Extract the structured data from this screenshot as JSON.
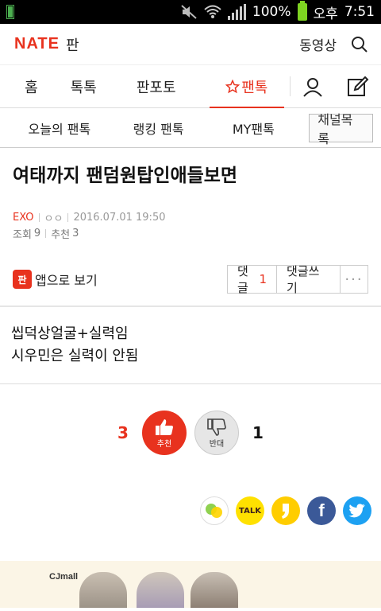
{
  "status_bar": {
    "battery_percent": "100%",
    "ampm": "오후",
    "time": "7:51"
  },
  "header": {
    "logo": "NATE",
    "section": "판",
    "video_link": "동영상"
  },
  "main_nav": {
    "tabs": [
      {
        "label": "홈"
      },
      {
        "label": "톡톡"
      },
      {
        "label": "판포토"
      },
      {
        "label": "팬톡",
        "active": true
      }
    ]
  },
  "sub_nav": {
    "tabs": [
      {
        "label": "오늘의 팬톡"
      },
      {
        "label": "랭킹 팬톡"
      },
      {
        "label": "MY팬톡"
      }
    ],
    "channel_button": "채널목록"
  },
  "article": {
    "title": "여태까지 팬덤원탑인애들보면",
    "channel": "EXO",
    "author": "ㅇㅇ",
    "datetime": "2016.07.01 19:50",
    "views_label": "조회",
    "views": "9",
    "recommend_label": "추천",
    "recommend": "3",
    "body_lines": [
      "씹덕상얼굴+실력임",
      "시우민은 실력이 안됨"
    ]
  },
  "actions": {
    "app_badge": "판",
    "app_view": "앱으로 보기",
    "comments_label": "댓글",
    "comments_count": "1",
    "write_comment": "댓글쓰기",
    "more": "···"
  },
  "votes": {
    "up_count": "3",
    "up_label": "추천",
    "down_label": "반대",
    "down_count": "1"
  },
  "share": {
    "talk_label": "TALK",
    "facebook": "f"
  },
  "ad": {
    "brand": "CJmall"
  },
  "colors": {
    "accent": "#e8321e",
    "facebook": "#3b5998",
    "twitter": "#1da1f2",
    "kakao": "#ffe100"
  }
}
